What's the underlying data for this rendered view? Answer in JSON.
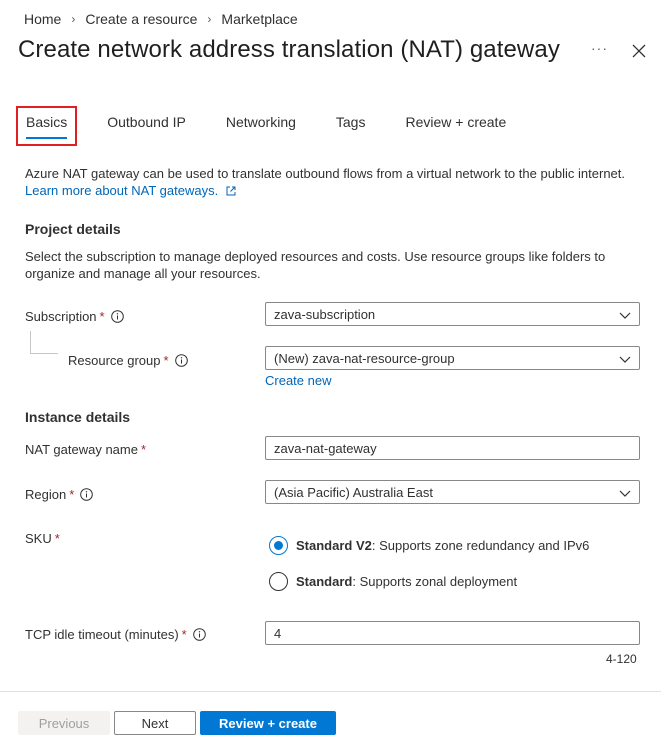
{
  "breadcrumb": [
    "Home",
    "Create a resource",
    "Marketplace"
  ],
  "title": "Create network address translation (NAT) gateway",
  "header_more": "···",
  "tabs": [
    "Basics",
    "Outbound IP",
    "Networking",
    "Tags",
    "Review + create"
  ],
  "active_tab": "Basics",
  "intro": {
    "text": "Azure NAT gateway can be used to translate outbound flows from a virtual network to the public internet.",
    "link": "Learn more about NAT gateways."
  },
  "project": {
    "title": "Project details",
    "desc": "Select the subscription to manage deployed resources and costs. Use resource groups like folders to organize and manage all your resources.",
    "subscription_label": "Subscription",
    "subscription_value": "zava-subscription",
    "rg_label": "Resource group",
    "rg_value": "(New) zava-nat-resource-group",
    "create_new": "Create new"
  },
  "instance": {
    "title": "Instance details",
    "name_label": "NAT gateway name",
    "name_value": "zava-nat-gateway",
    "region_label": "Region",
    "region_value": "(Asia Pacific) Australia East",
    "sku_label": "SKU",
    "sku_options": [
      {
        "name": "Standard V2",
        "desc": ": Supports zone redundancy and IPv6",
        "selected": true
      },
      {
        "name": "Standard",
        "desc": ": Supports zonal deployment",
        "selected": false
      }
    ],
    "timeout_label": "TCP idle timeout (minutes)",
    "timeout_value": "4",
    "timeout_hint": "4-120"
  },
  "required_mark": "*",
  "footer": {
    "previous": "Previous",
    "next": "Next",
    "review": "Review + create"
  },
  "colors": {
    "accent": "#0078d4",
    "link": "#0066b8",
    "required": "#a4262c",
    "highlight": "#e02020"
  }
}
